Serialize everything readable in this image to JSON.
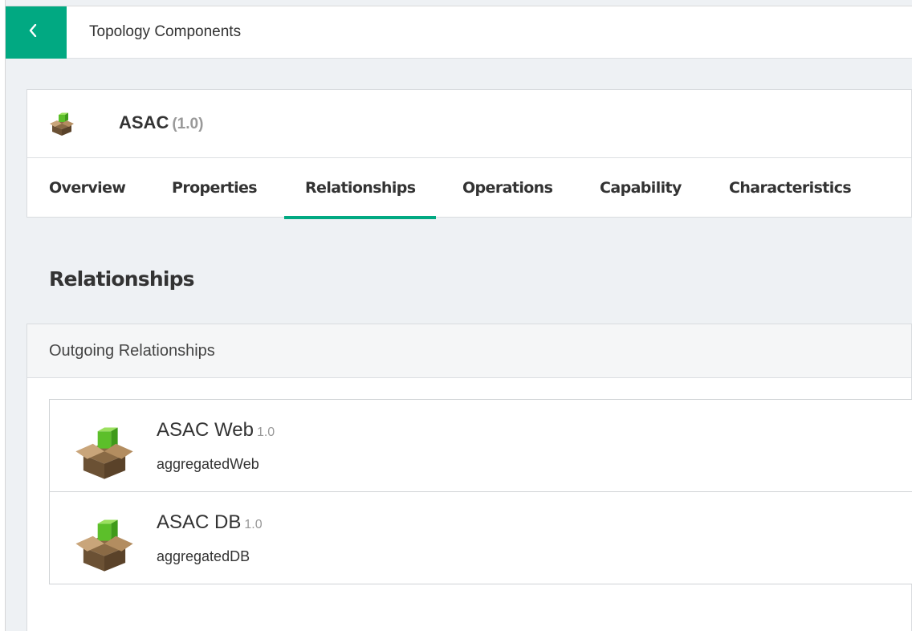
{
  "header": {
    "back_icon": "chevron-left-icon",
    "title": "Topology Components",
    "accent_color": "#01a982"
  },
  "component": {
    "icon": "package-box-icon",
    "name": "ASAC",
    "version": "(1.0)"
  },
  "tabs": [
    {
      "label": "Overview",
      "active": false
    },
    {
      "label": "Properties",
      "active": false
    },
    {
      "label": "Relationships",
      "active": true
    },
    {
      "label": "Operations",
      "active": false
    },
    {
      "label": "Capability",
      "active": false
    },
    {
      "label": "Characteristics",
      "active": false
    }
  ],
  "section": {
    "title": "Relationships"
  },
  "outgoing": {
    "header": "Outgoing Relationships",
    "items": [
      {
        "icon": "package-box-icon",
        "name": "ASAC Web",
        "version": "1.0",
        "relationship": "aggregatedWeb"
      },
      {
        "icon": "package-box-icon",
        "name": "ASAC DB",
        "version": "1.0",
        "relationship": "aggregatedDB"
      }
    ]
  }
}
